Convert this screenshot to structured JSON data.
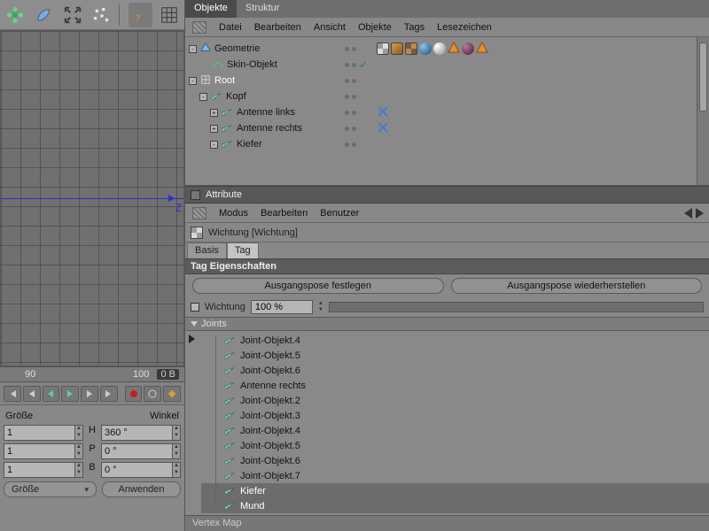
{
  "top_tabs": {
    "objects": "Objekte",
    "structure": "Struktur"
  },
  "om_menu": [
    "Datei",
    "Bearbeiten",
    "Ansicht",
    "Objekte",
    "Tags",
    "Lesezeichen"
  ],
  "om_tree": [
    {
      "indent": 0,
      "exp": "-",
      "icon": "poly",
      "label": "Geometrie",
      "sel": false,
      "check": false
    },
    {
      "indent": 1,
      "exp": "",
      "icon": "skin",
      "label": "Skin-Objekt",
      "sel": false,
      "check": true
    },
    {
      "indent": 0,
      "exp": "-",
      "icon": "null",
      "label": "Root",
      "sel": true,
      "check": false
    },
    {
      "indent": 1,
      "exp": "-",
      "icon": "bone",
      "label": "Kopf",
      "sel": false,
      "check": false
    },
    {
      "indent": 2,
      "exp": "+",
      "icon": "bone",
      "label": "Antenne links",
      "sel": false,
      "check": false,
      "cross": true
    },
    {
      "indent": 2,
      "exp": "+",
      "icon": "bone",
      "label": "Antenne rechts",
      "sel": false,
      "check": false,
      "cross": true
    },
    {
      "indent": 2,
      "exp": "-",
      "icon": "bone",
      "label": "Kiefer",
      "sel": false,
      "check": false
    }
  ],
  "attr": {
    "title": "Attribute",
    "menu": [
      "Modus",
      "Bearbeiten",
      "Benutzer"
    ],
    "head": "Wichtung [Wichtung]",
    "subtabs": {
      "basis": "Basis",
      "tag": "Tag"
    },
    "section": "Tag Eigenschaften",
    "btn_set": "Ausgangspose festlegen",
    "btn_restore": "Ausgangspose wiederherstellen",
    "weight_label": "Wichtung",
    "weight_value": "100 %",
    "joints_label": "Joints",
    "joints": [
      "Joint-Objekt.4",
      "Joint-Objekt.5",
      "Joint-Objekt.6",
      "Antenne rechts",
      "Joint-Objekt.2",
      "Joint-Objekt.3",
      "Joint-Objekt.4",
      "Joint-Objekt.5",
      "Joint-Objekt.6",
      "Joint-Objekt.7",
      "Kiefer",
      "Mund"
    ],
    "joints_sel": [
      10,
      11
    ],
    "vertex_map": "Vertex Map"
  },
  "viewport": {
    "axis_label": "Z",
    "ruler_a": "90",
    "ruler_b": "100",
    "frame": "0 B"
  },
  "coords": {
    "size_label": "Größe",
    "angle_label": "Winkel",
    "rows": [
      {
        "l": "1",
        "ax": "H",
        "r": "360 °"
      },
      {
        "l": "1",
        "ax": "P",
        "r": "0 °"
      },
      {
        "l": "1",
        "ax": "B",
        "r": "0 °"
      }
    ],
    "combo": "Größe",
    "apply": "Anwenden"
  }
}
